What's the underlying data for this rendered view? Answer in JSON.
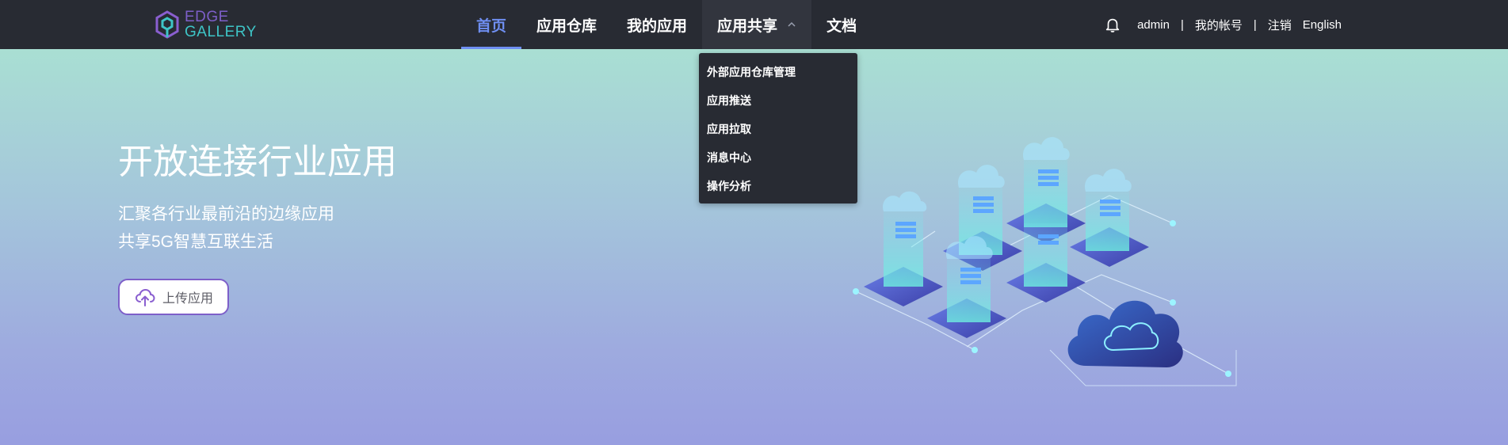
{
  "logo": {
    "line1": "EDGE",
    "line2": "GALLERY",
    "icon": "cube-logo-icon"
  },
  "nav": {
    "items": [
      {
        "label": "首页",
        "active": true
      },
      {
        "label": "应用仓库"
      },
      {
        "label": "我的应用"
      },
      {
        "label": "应用共享",
        "open": true
      },
      {
        "label": "文档"
      }
    ]
  },
  "dropdown": {
    "items": [
      "外部应用仓库管理",
      "应用推送",
      "应用拉取",
      "消息中心",
      "操作分析"
    ]
  },
  "user_menu": {
    "bell_icon": "bell-icon",
    "username": "admin",
    "separator": "|",
    "account": "我的帐号",
    "logout": "注销",
    "language": "English"
  },
  "hero": {
    "title": "开放连接行业应用",
    "subtitle_1": "汇聚各行业最前沿的边缘应用",
    "subtitle_2": "共享5G智慧互联生活",
    "upload_label": "上传应用",
    "upload_icon": "cloud-upload-icon"
  },
  "colors": {
    "nav_bg": "#282b33",
    "nav_active": "#6f8ff2",
    "brand_purple": "#7d5fc9",
    "brand_teal": "#3ec5c7"
  }
}
